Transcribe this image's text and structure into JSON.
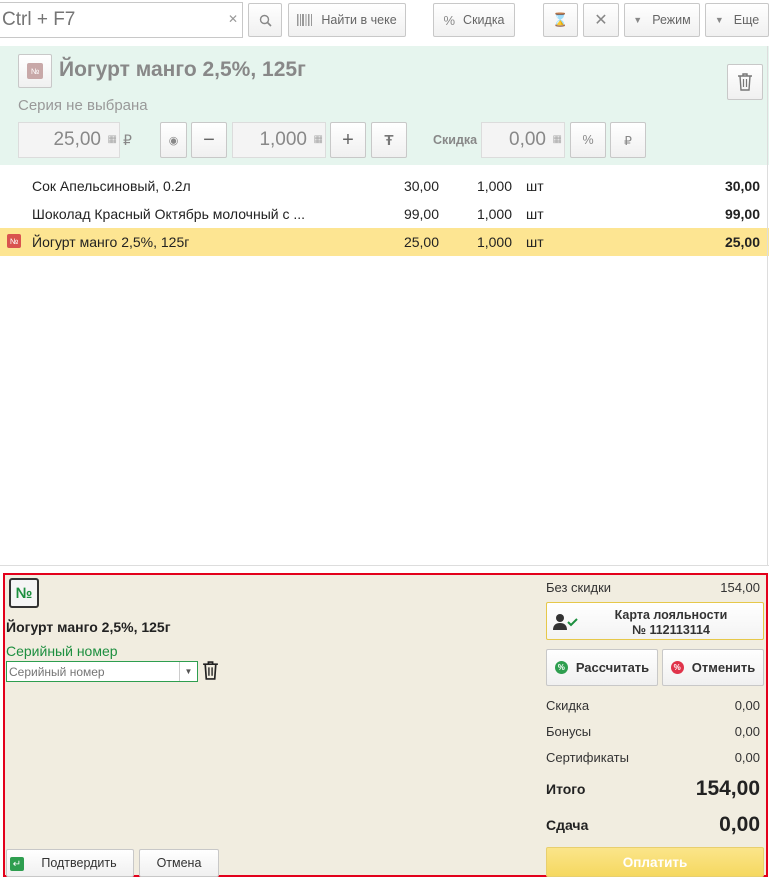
{
  "toolbar": {
    "search_placeholder": "Ctrl + F7",
    "find_in_receipt": "Найти в чеке",
    "discount": "Скидка",
    "mode": "Режим",
    "more": "Еще"
  },
  "item": {
    "title": "Йогурт манго 2,5%, 125г",
    "series": "Серия не выбрана",
    "price": "25,00",
    "currency": "₽",
    "quantity": "1,000",
    "discount_label": "Скидка",
    "discount_value": "0,00",
    "percent_symbol": "%",
    "rub_symbol": "₽"
  },
  "lines": [
    {
      "name": "Сок Апельсиновый, 0.2л",
      "price": "30,00",
      "qty": "1,000",
      "unit": "шт",
      "sum": "30,00",
      "selected": false
    },
    {
      "name": "Шоколад Красный Октябрь молочный с ...",
      "price": "99,00",
      "qty": "1,000",
      "unit": "шт",
      "sum": "99,00",
      "selected": false
    },
    {
      "name": "Йогурт манго 2,5%, 125г",
      "price": "25,00",
      "qty": "1,000",
      "unit": "шт",
      "sum": "25,00",
      "selected": true
    }
  ],
  "bottom": {
    "num_icon": "№",
    "title": "Йогурт манго 2,5%, 125г",
    "serial_label": "Серийный номер",
    "serial_placeholder": "Серийный номер",
    "confirm": "Подтвердить",
    "cancel": "Отмена"
  },
  "summary": {
    "no_discount_label": "Без скидки",
    "no_discount_value": "154,00",
    "loyalty_line1": "Карта лояльности",
    "loyalty_line2": "№ 112113114",
    "calculate": "Рассчитать",
    "revoke": "Отменить",
    "discount_label": "Скидка",
    "discount_value": "0,00",
    "bonuses_label": "Бонусы",
    "bonuses_value": "0,00",
    "certificates_label": "Сертификаты",
    "certificates_value": "0,00",
    "total_label": "Итого",
    "total_value": "154,00",
    "change_label": "Сдача",
    "change_value": "0,00",
    "pay": "Оплатить"
  },
  "colors": {
    "accent_green": "#1d8f3f",
    "selection": "#fde592",
    "highlight_border": "#e3001b",
    "item_panel_bg": "#e6f5ee",
    "bottom_bg": "#f1ede0"
  }
}
